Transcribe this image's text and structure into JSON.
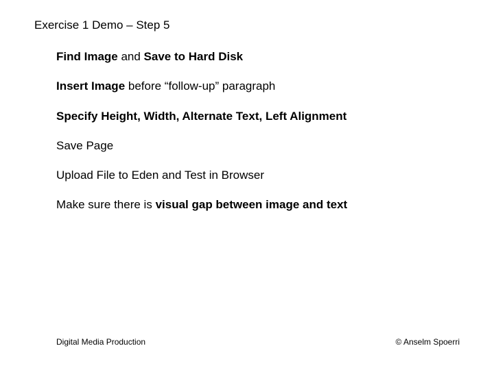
{
  "title": "Exercise 1 Demo – Step 5",
  "items": {
    "line1": {
      "s0": "Find Image",
      "s1": " and ",
      "s2": "Save to Hard Disk"
    },
    "line2": {
      "s0": "Insert Image",
      "s1": " before “follow-up” paragraph"
    },
    "line3": {
      "s0": "Specify Height, Width, Alternate Text, Left Alignment"
    },
    "line4": {
      "s0": "Save Page"
    },
    "line5": {
      "s0": "Upload File to Eden and Test in Browser"
    },
    "line6": {
      "s0": "Make sure there is ",
      "s1": "visual gap between image and text"
    }
  },
  "footer": {
    "left": "Digital Media Production",
    "right": "© Anselm Spoerri"
  }
}
